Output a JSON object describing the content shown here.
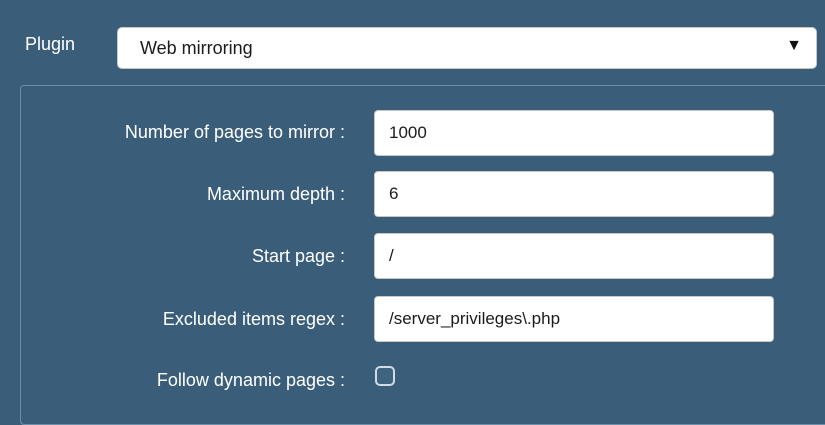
{
  "plugin": {
    "label": "Plugin",
    "selected": "Web mirroring",
    "arrow": "▼"
  },
  "fields": [
    {
      "label": "Number of pages to mirror :",
      "value": "1000"
    },
    {
      "label": "Maximum depth :",
      "value": "6"
    },
    {
      "label": "Start page :",
      "value": "/"
    },
    {
      "label": "Excluded items regex :",
      "value": "/server_privileges\\.php"
    }
  ],
  "dynamic": {
    "label": "Follow dynamic pages :",
    "checked": false
  },
  "colors": {
    "background": "#3a5e7a",
    "input_background": "#ffffff",
    "text_light": "#ffffff",
    "text_dark": "#1b1b1b"
  }
}
